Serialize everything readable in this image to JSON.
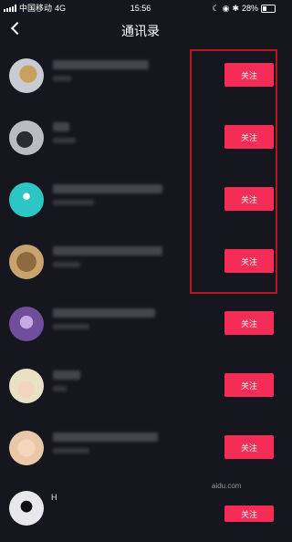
{
  "status_bar": {
    "carrier": "中国移动",
    "network": "4G",
    "time": "15:56",
    "battery": "28%"
  },
  "header": {
    "title": "通讯录"
  },
  "contacts": [
    {
      "name": "",
      "follow_label": "关注"
    },
    {
      "name": "",
      "follow_label": "关注"
    },
    {
      "name": "",
      "follow_label": "关注"
    },
    {
      "name": "",
      "follow_label": "关注"
    },
    {
      "name": "",
      "follow_label": "关注"
    },
    {
      "name": "",
      "follow_label": "关注"
    },
    {
      "name": "",
      "follow_label": "关注"
    },
    {
      "name": "H",
      "follow_label": "关注"
    }
  ],
  "watermark": "aidu.com",
  "colors": {
    "background": "#16161f",
    "follow_button": "#f52c55",
    "highlight_border": "#b8161c"
  }
}
